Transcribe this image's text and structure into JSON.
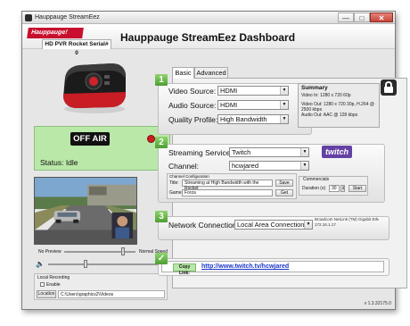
{
  "window": {
    "title": "Hauppauge StreamEez",
    "min_glyph": "—",
    "max_glyph": "□",
    "close_glyph": "✕"
  },
  "header": {
    "logo_text": "Hauppauge!",
    "dashboard_title": "Hauppauge StreamEez Dashboard",
    "device_tab": "HD PVR Rocket  Serial# 0"
  },
  "status": {
    "on_air_label": "OFF AIR",
    "status_text": "Status: Idle"
  },
  "preview_controls": {
    "slider_left_label": "No Preview",
    "slider_right_label": "Normal Speed",
    "volume_icon": "speaker-icon"
  },
  "local_recording": {
    "heading": "Local Recording",
    "enable_label": "Enable",
    "location_button": "Location",
    "path": "C:\\Users\\graphics2\\Videos"
  },
  "tabs": [
    "Basic",
    "Advanced"
  ],
  "step1": {
    "num": "1",
    "video_source_label": "Video Source:",
    "video_source": "HDMI",
    "audio_source_label": "Audio Source:",
    "audio_source": "HDMI",
    "quality_label": "Quality Profile:",
    "quality": "High Bandwidth"
  },
  "summary": {
    "title": "Summary",
    "line1": "Video In: 1280 x 720 60p",
    "line2": "Video Out: 1280 x 720 30p, H.264 @",
    "line3": "2500 kbps",
    "line4": "Audio Out: AAC @ 128 kbps"
  },
  "step2": {
    "num": "2",
    "service_label": "Streaming Service:",
    "service": "Twitch",
    "channel_label": "Channel:",
    "channel": "hcwjared",
    "brand_logo": "twitch",
    "config_title": "Channel Configuration",
    "title_label": "Title:",
    "title_value": "Streaming at High Bandwidth with the Rocket",
    "game_label": "Game:",
    "game_value": "Forza",
    "save_button": "Save",
    "get_button": "Get",
    "commercials_title": "Commercials",
    "duration_label": "Duration (s)",
    "duration_value": "30",
    "start_button": "Start"
  },
  "step3": {
    "num": "3",
    "network_label": "Network Connection",
    "network": "Local Area Connection",
    "adapter_line1": "Broadcom NetLink (TM) Gigabit Ether",
    "adapter_line2": "172.16.1.17"
  },
  "copy": {
    "check": "✓",
    "button": "Copy Link:",
    "link": "http://www.twitch.tv/hcwjared"
  },
  "version": "v 1.3.32175.0",
  "colors": {
    "accent_green": "#4e9e33",
    "status_green": "#b9e8a8",
    "twitch_purple": "#6441a4",
    "brand_red": "#c8102e",
    "rec_red": "#cc1e1e"
  }
}
